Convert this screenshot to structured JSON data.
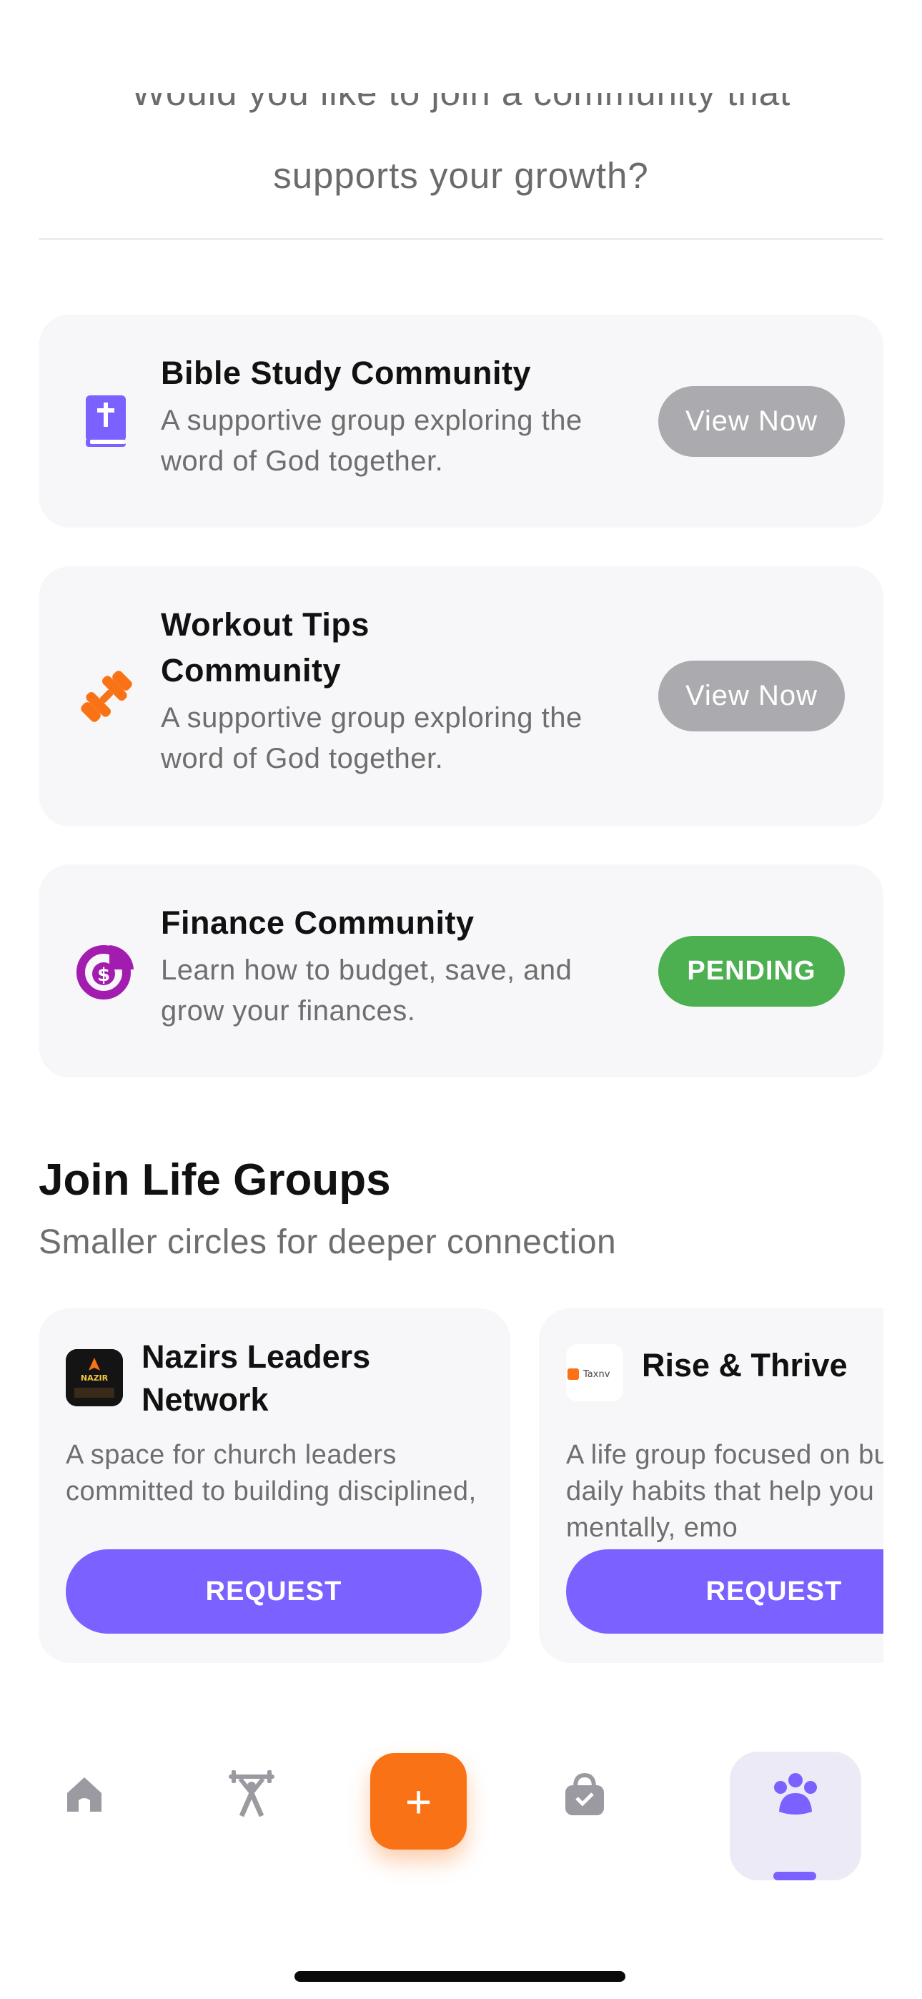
{
  "intro": {
    "line1": "Would you like to join a community that",
    "line2": "supports your growth?"
  },
  "communities": [
    {
      "title": "Bible Study Community",
      "description": "A supportive group exploring the word of God together.",
      "action": "View Now",
      "icon": "bible-icon",
      "status_color": "#ababaf"
    },
    {
      "title": "Workout Tips Community",
      "description": "A supportive group exploring the word of God together.",
      "action": "View Now",
      "icon": "dumbbell-icon",
      "status_color": "#ababaf"
    },
    {
      "title": "Finance Community",
      "description": "Learn how to budget, save, and grow your finances.",
      "action": "PENDING",
      "icon": "finance-icon",
      "status_color": "#4caf50"
    }
  ],
  "life_groups": {
    "title": "Join Life Groups",
    "subtitle": "Smaller circles for deeper connection",
    "groups": [
      {
        "name": "Nazirs Leaders Network",
        "description": "A space for church leaders committed to building disciplined, engaged, and ar",
        "button": "REQUEST",
        "logo_text": "NAZIR"
      },
      {
        "name": "Rise & Thrive",
        "description": "A life group focused on building daily habits that help you grow mentally, emo",
        "button": "REQUEST",
        "logo_text": "Taxnv"
      }
    ]
  },
  "tabbar": {
    "fab_label": "+",
    "items": [
      "home-icon",
      "workout-icon",
      "add-icon",
      "shop-icon",
      "community-icon"
    ]
  },
  "colors": {
    "accent": "#7b61ff",
    "fab": "#f97316",
    "pending": "#4caf50",
    "muted_button": "#ababaf"
  }
}
